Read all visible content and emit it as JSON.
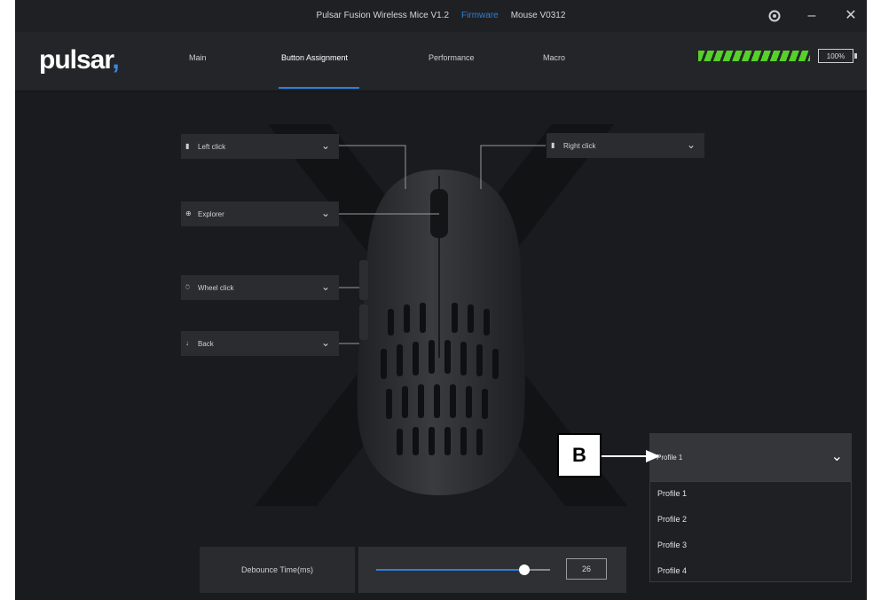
{
  "titlebar": {
    "app_title": "Pulsar Fusion Wireless Mice V1.2",
    "firmware_label": "Firmware",
    "device_label": "Mouse V0312",
    "settings_icon": "gear-icon",
    "minimize_icon": "minimize-icon",
    "close_icon": "close-icon"
  },
  "nav": {
    "logo_text": "pulsar",
    "logo_mark": ",",
    "tabs": [
      {
        "label": "Main"
      },
      {
        "label": "Button Assignment"
      },
      {
        "label": "Performance"
      },
      {
        "label": "Macro"
      }
    ],
    "active_tab": "Button Assignment",
    "battery_percent": "100%",
    "battery_level": 1.0,
    "battery_color": "#55d12a",
    "accent_color": "#2f7fd8"
  },
  "buttons": {
    "left_click": {
      "icon": "mouse-left-icon",
      "glyph": "▮",
      "label": "Left click"
    },
    "right_click": {
      "icon": "mouse-right-icon",
      "glyph": "▮",
      "label": "Right click"
    },
    "explorer": {
      "icon": "explorer-icon",
      "glyph": "⊕",
      "label": "Explorer"
    },
    "wheel_click": {
      "icon": "wheel-icon",
      "glyph": "⍥",
      "label": "Wheel click"
    },
    "back": {
      "icon": "back-icon",
      "glyph": "↓",
      "label": "Back"
    }
  },
  "debounce": {
    "label": "Debounce Time(ms)",
    "value": "26",
    "slider_level": 0.85
  },
  "profile": {
    "selected": "Profile 1",
    "options": [
      "Profile 1",
      "Profile 2",
      "Profile 3",
      "Profile 4"
    ]
  },
  "annotation": {
    "callout_letter": "B"
  }
}
